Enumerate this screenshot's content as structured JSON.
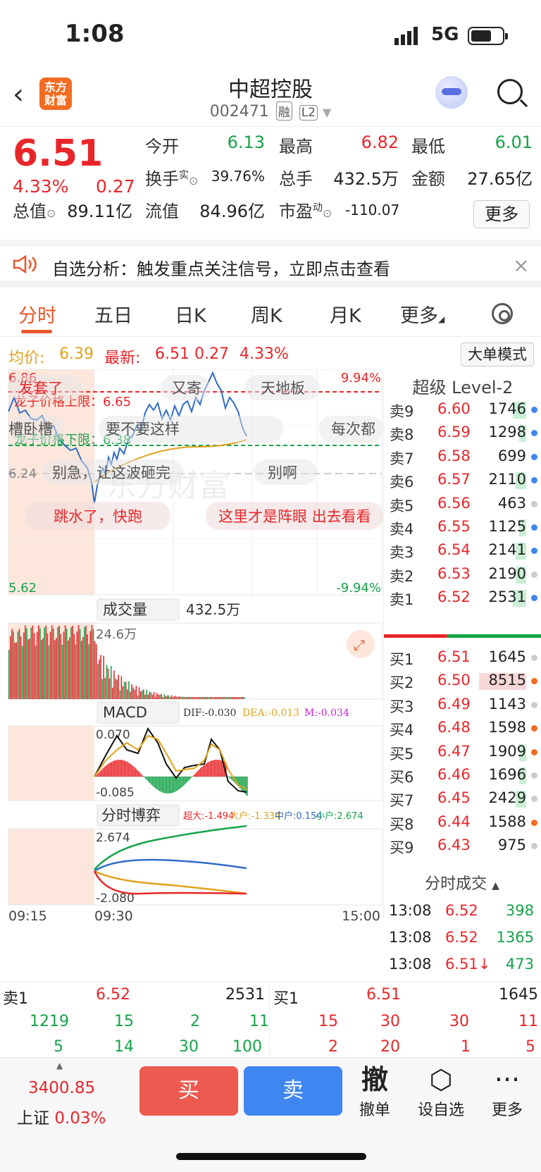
{
  "status": {
    "time": "1:08",
    "network": "5G"
  },
  "nav": {
    "back_icon": "chevron-left-icon",
    "logo_line1": "东方",
    "logo_line2": "财富",
    "title": "中超控股",
    "code": "002471",
    "tag1": "融",
    "tag2": "L2",
    "dropdown_icon": "caret-down-icon"
  },
  "quote": {
    "price": "6.51",
    "pct": "4.33%",
    "change": "0.27",
    "open_label": "今开",
    "open": "6.13",
    "high_label": "最高",
    "high": "6.82",
    "low_label": "最低",
    "low": "6.01",
    "turnover_label": "换手",
    "turnover_sup": "实",
    "turnover": "39.76%",
    "volume_label": "总手",
    "volume": "432.5万",
    "amount_label": "金额",
    "amount": "27.65亿",
    "mktcap_label": "总值",
    "mktcap": "89.11亿",
    "float_label": "流值",
    "float": "84.96亿",
    "pe_label": "市盈",
    "pe_sup": "动",
    "pe": "-110.07",
    "more": "更多"
  },
  "alert": {
    "text": "自选分析：触发重点关注信号，立即点击查看",
    "close": "×"
  },
  "tabs": [
    "分时",
    "五日",
    "日K",
    "周K",
    "月K",
    "更多"
  ],
  "avgline": {
    "avg_label": "均价:",
    "avg": "6.39",
    "latest_label": "最新:",
    "latest": "6.51",
    "chg": "0.27",
    "pct": "4.33%",
    "big_order": "大单模式"
  },
  "chart": {
    "ymax": "6.86",
    "ymin": "5.62",
    "pct_max": "9.94%",
    "pct_min": "-9.94%",
    "ref": "6.24",
    "upper_limit": "龙子价格上限：6.65",
    "lower_limit": "龙子价格下限：6.38",
    "bullets": [
      "发套了",
      "又寄",
      "天地板",
      "要不要这样",
      "每次都",
      "别急，让这波砸完",
      "别啊",
      "跳水了，快跑",
      "这里才是阵眼 出去看看",
      "槽卧槽"
    ],
    "vol_label": "成交量",
    "vol_total": "432.5万",
    "vol_max": "24.6万",
    "macd_label": "MACD",
    "dif": "DIF:-0.030",
    "dea": "DEA:-0.013",
    "m": "M:-0.034",
    "macd_top": "0.070",
    "macd_bot": "-0.085",
    "game_label": "分时博弈",
    "super": "超大:-1.494",
    "big": "大户:-1.334",
    "mid": "中户:0.154",
    "small": "小户:2.674",
    "game_top": "2.674",
    "game_bot": "-2.080",
    "t_start": "09:15",
    "t_open": "09:30",
    "t_end": "15:00",
    "watermark": "东方财富"
  },
  "book": {
    "title": "超级 Level-2",
    "asks": [
      {
        "label": "卖9",
        "price": "6.60",
        "vol": "1746",
        "dot": "#3f86f0",
        "bar": 0.1
      },
      {
        "label": "卖8",
        "price": "6.59",
        "vol": "1298",
        "dot": "#3f86f0",
        "bar": 0.05
      },
      {
        "label": "卖7",
        "price": "6.58",
        "vol": "699",
        "dot": "#3f86f0",
        "bar": 0.0
      },
      {
        "label": "卖6",
        "price": "6.57",
        "vol": "2110",
        "dot": "#3f86f0",
        "bar": 0.08
      },
      {
        "label": "卖5",
        "price": "6.56",
        "vol": "463",
        "dot": "#cccccc",
        "bar": 0.0
      },
      {
        "label": "卖4",
        "price": "6.55",
        "vol": "1125",
        "dot": "#3f86f0",
        "bar": 0.05
      },
      {
        "label": "卖3",
        "price": "6.54",
        "vol": "2141",
        "dot": "#3f86f0",
        "bar": 0.08
      },
      {
        "label": "卖2",
        "price": "6.53",
        "vol": "2190",
        "dot": "#cccccc",
        "bar": 0.08
      },
      {
        "label": "卖1",
        "price": "6.52",
        "vol": "2531",
        "dot": "#3f86f0",
        "bar": 0.1
      }
    ],
    "bids": [
      {
        "label": "买1",
        "price": "6.51",
        "vol": "1645",
        "dot": "#cccccc",
        "bar": 0.0
      },
      {
        "label": "买2",
        "price": "6.50",
        "vol": "8515",
        "dot": "#f36c21",
        "bar": 0.35
      },
      {
        "label": "买3",
        "price": "6.49",
        "vol": "1143",
        "dot": "#cccccc",
        "bar": 0.0
      },
      {
        "label": "买4",
        "price": "6.48",
        "vol": "1598",
        "dot": "#f36c21",
        "bar": 0.0
      },
      {
        "label": "买5",
        "price": "6.47",
        "vol": "1909",
        "dot": "#f36c21",
        "bar": 0.05
      },
      {
        "label": "买6",
        "price": "6.46",
        "vol": "1696",
        "dot": "#cccccc",
        "bar": 0.05
      },
      {
        "label": "买7",
        "price": "6.45",
        "vol": "2429",
        "dot": "#cccccc",
        "bar": 0.08
      },
      {
        "label": "买8",
        "price": "6.44",
        "vol": "1588",
        "dot": "#f36c21",
        "bar": 0.0
      },
      {
        "label": "买9",
        "price": "6.43",
        "vol": "975",
        "dot": "#cccccc",
        "bar": 0.0
      }
    ]
  },
  "ticks": {
    "title": "分时成交",
    "rows": [
      {
        "time": "13:08",
        "price": "6.52",
        "vol": "398"
      },
      {
        "time": "13:08",
        "price": "6.52",
        "vol": "1365"
      },
      {
        "time": "13:08",
        "price": "6.51↓",
        "vol": "473"
      }
    ]
  },
  "level1": {
    "sell_label": "卖1",
    "sell_price": "6.52",
    "sell_vol": "2531",
    "buy_label": "买1",
    "buy_price": "6.51",
    "buy_vol": "1645",
    "sell_r1": [
      "1219",
      "15",
      "2",
      "11"
    ],
    "sell_r2": [
      "5",
      "14",
      "30",
      "100"
    ],
    "buy_r1": [
      "15",
      "30",
      "30",
      "11"
    ],
    "buy_r2": [
      "2",
      "20",
      "1",
      "5"
    ]
  },
  "bottom": {
    "index_value": "3400.85",
    "index_name": "上证",
    "index_pct": "0.03%",
    "buy": "买",
    "sell": "卖",
    "cancel_icon": "撤",
    "cancel": "撤单",
    "watch": "设自选",
    "more": "更多"
  }
}
